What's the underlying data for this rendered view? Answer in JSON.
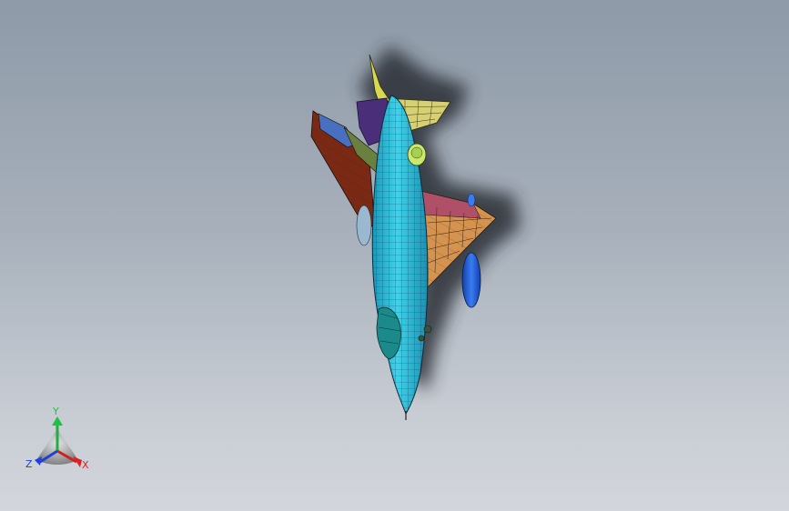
{
  "viewport": {
    "background_top": "#8e9aa8",
    "background_bottom": "#d3d6dc"
  },
  "model": {
    "label": "jet-aircraft-model",
    "colors": {
      "fuselage": "#33c6e0",
      "fuselage_dark": "#1fa0bd",
      "left_wing_outer": "#8b3a1a",
      "left_wing_inner": "#a05a2a",
      "right_wing": "#d49450",
      "right_wing_root": "#b05060",
      "h_stabilizer": "#d8d070",
      "v_stabilizer": "#d8d850",
      "tail_dark": "#4a2e7a",
      "drop_tank": "#2060d8",
      "intake": "#c8e870",
      "shadow": "#2a2e35"
    }
  },
  "triad": {
    "x_label": "X",
    "y_label": "Y",
    "z_label": "Z",
    "x_color": "#e02020",
    "y_color": "#20c040",
    "z_color": "#2040e0"
  }
}
